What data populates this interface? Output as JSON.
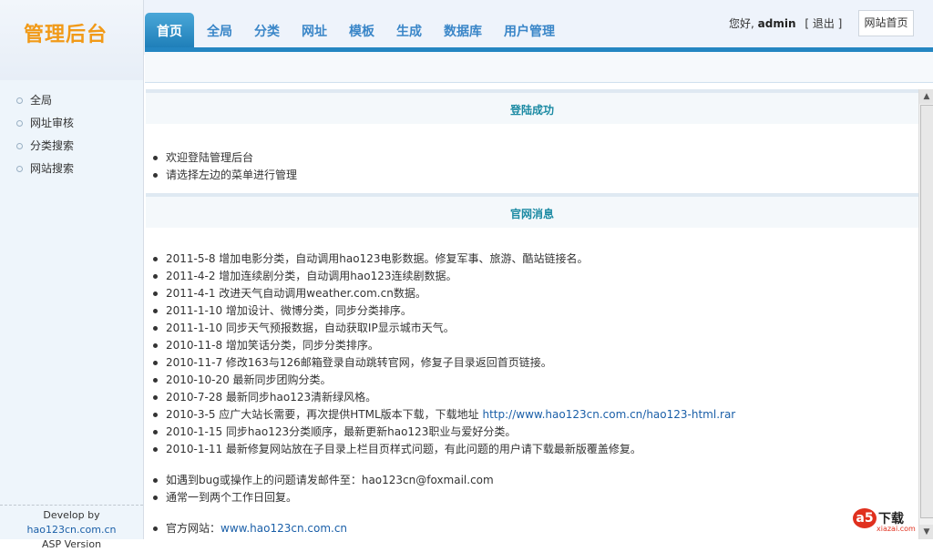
{
  "header": {
    "logo": "管理后台",
    "tabs": [
      "首页",
      "全局",
      "分类",
      "网址",
      "模板",
      "生成",
      "数据库",
      "用户管理"
    ],
    "greeting": "您好,",
    "username": "admin",
    "logout": "[ 退出 ]",
    "home_button": "网站首页"
  },
  "sidebar": {
    "items": [
      "全局",
      "网址审核",
      "分类搜索",
      "网站搜索"
    ],
    "footer_prefix": "Develop by ",
    "footer_link": "hao123cn.com.cn",
    "footer_version": "ASP Version"
  },
  "main": {
    "login_title": "登陆成功",
    "login_items": [
      "欢迎登陆管理后台",
      "请选择左边的菜单进行管理"
    ],
    "news_title": "官网消息",
    "news_items": [
      "2011-5-8 增加电影分类，自动调用hao123电影数据。修复军事、旅游、酷站链接名。",
      "2011-4-2 增加连续剧分类，自动调用hao123连续剧数据。",
      "2011-4-1 改进天气自动调用weather.com.cn数据。",
      "2011-1-10 增加设计、微博分类，同步分类排序。",
      "2011-1-10 同步天气预报数据，自动获取IP显示城市天气。",
      "2010-11-8 增加笑话分类，同步分类排序。",
      "2010-11-7 修改163与126邮箱登录自动跳转官网，修复子目录返回首页链接。",
      "2010-10-20 最新同步团购分类。",
      "2010-7-28 最新同步hao123清新绿风格。",
      "2010-3-5 应广大站长需要，再次提供HTML版本下载，下载地址 ",
      "2010-1-15 同步hao123分类顺序，最新更新hao123职业与爱好分类。",
      "2010-1-11 最新修复网站放在子目录上栏目页样式问题，有此问题的用户请下载最新版覆盖修复。"
    ],
    "download_link": "http://www.hao123cn.com.cn/hao123-html.rar",
    "contact_items": [
      "如遇到bug或操作上的问题请发邮件至：hao123cn@foxmail.com",
      "通常一到两个工作日回复。"
    ],
    "official_label": "官方网站：",
    "official_link": "www.hao123cn.com.cn"
  },
  "watermark": {
    "circle": "a5",
    "text": "下载",
    "sub": "xiazai.com"
  },
  "colors": {
    "accent": "#2486c2",
    "logo": "#f19a18",
    "section_title": "#1b8aa3"
  }
}
